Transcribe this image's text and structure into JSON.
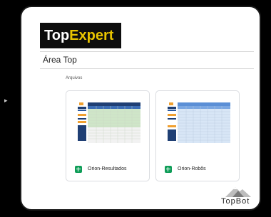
{
  "side_icon": "chevron-right-icon",
  "logo": {
    "part1": "Top",
    "part2": "Expert"
  },
  "page": {
    "title": "Área Top"
  },
  "section": {
    "title": "Arquivos"
  },
  "files": [
    {
      "name": "Orion-Resultados",
      "icon": "google-sheets-icon"
    },
    {
      "name": "Orion-Robôs",
      "icon": "google-sheets-icon"
    }
  ],
  "brand": {
    "name": "TopBot",
    "icon": "mountain-icon"
  },
  "colors": {
    "background": "#000000",
    "panel": "#ffffff",
    "logo_bg": "#0d0d0d",
    "logo_accent": "#e8c400",
    "sheets_green": "#0f9d58",
    "sheet_header_blue": "#1f3f74"
  }
}
